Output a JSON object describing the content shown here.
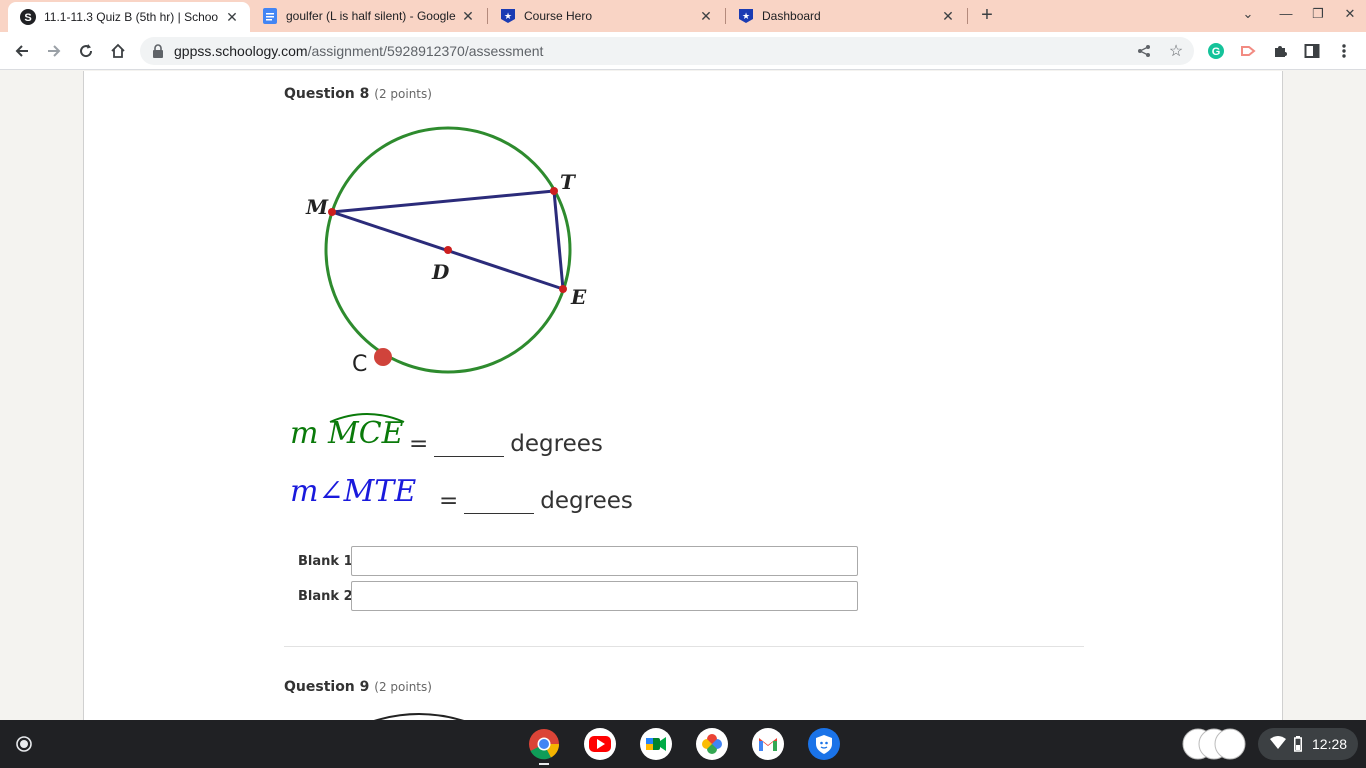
{
  "browser": {
    "tabs": [
      {
        "title": "11.1-11.3 Quiz B (5th hr) | Schoo",
        "favicon": "schoology-icon",
        "active": true
      },
      {
        "title": "goulfer (L is half silent) - Google",
        "favicon": "google-docs-icon",
        "active": false
      },
      {
        "title": "Course Hero",
        "favicon": "course-hero-icon",
        "active": false
      },
      {
        "title": "Dashboard",
        "favicon": "course-hero-icon",
        "active": false
      }
    ],
    "url_host": "gppss.schoology.com",
    "url_path": "/assignment/5928912370/assessment",
    "accent_color": "#f9d4c5"
  },
  "question8": {
    "label": "Question 8",
    "points": "(2 points)",
    "figure": {
      "labels": {
        "M": "M",
        "T": "T",
        "D": "D",
        "E": "E",
        "C": "C"
      },
      "circle_color": "#2e8b2e",
      "segment_color": "#2b2b7a",
      "point_color": "#cc1f1f"
    },
    "eq1": {
      "prefix": "m",
      "arc": "MCE",
      "equals": "=",
      "unit": "degrees",
      "color": "#0a7a0a"
    },
    "eq2": {
      "prefix": "m∠",
      "angle": "MTE",
      "equals": "=",
      "unit": "degrees",
      "color": "#1a1adc"
    },
    "blank1_label": "Blank 1:",
    "blank2_label": "Blank 2:",
    "blank1_value": "",
    "blank2_value": ""
  },
  "question9": {
    "label": "Question 9",
    "points": "(2 points)"
  },
  "shelf": {
    "apps": [
      "chrome-icon",
      "youtube-icon",
      "google-meet-icon",
      "google-photos-icon",
      "gmail-icon",
      "security-shield-icon"
    ],
    "time": "12:28"
  }
}
